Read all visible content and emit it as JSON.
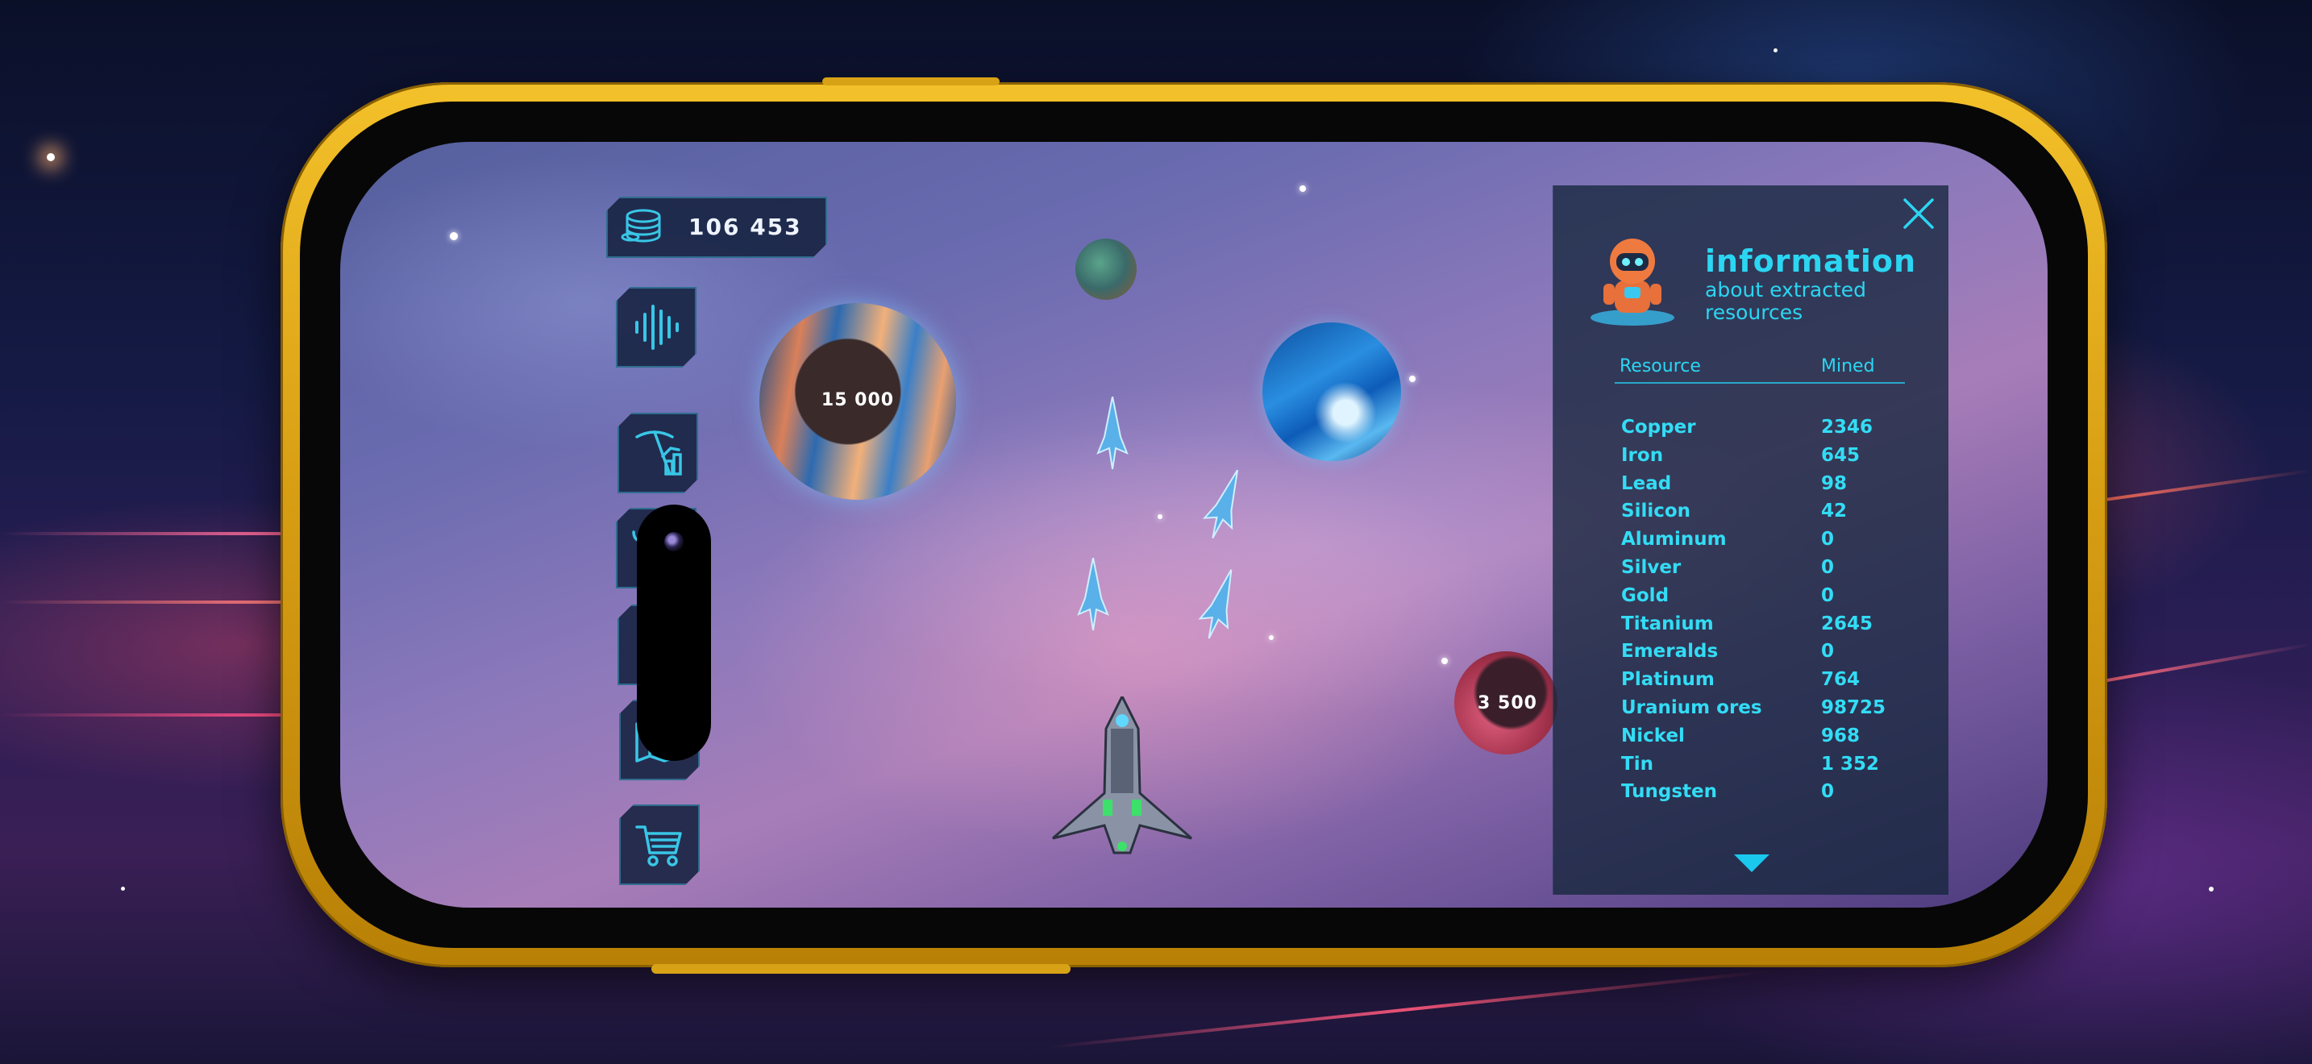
{
  "hud": {
    "coins": "106 453"
  },
  "planets": {
    "large_value": "15 000",
    "small_value": "3 500"
  },
  "info_panel": {
    "title": "information",
    "subtitle": "about extracted resources",
    "col_resource": "Resource",
    "col_mined": "Mined",
    "rows": [
      {
        "name": "Copper",
        "mined": "2346"
      },
      {
        "name": "Iron",
        "mined": "645"
      },
      {
        "name": "Lead",
        "mined": "98"
      },
      {
        "name": "Silicon",
        "mined": "42"
      },
      {
        "name": "Aluminum",
        "mined": "0"
      },
      {
        "name": "Silver",
        "mined": "0"
      },
      {
        "name": "Gold",
        "mined": "0"
      },
      {
        "name": "Titanium",
        "mined": "2645"
      },
      {
        "name": "Emeralds",
        "mined": "0"
      },
      {
        "name": "Platinum",
        "mined": "764"
      },
      {
        "name": "Uranium ores",
        "mined": "98725"
      },
      {
        "name": "Nickel",
        "mined": "968"
      },
      {
        "name": "Tin",
        "mined": "1 352"
      },
      {
        "name": "Tungsten",
        "mined": "0"
      }
    ]
  },
  "sidebar_icons": [
    "sound-wave-icon",
    "mining-pickaxe-icon",
    "cart-exchange-icon",
    "globe-icon",
    "map-icon",
    "shopping-cart-icon"
  ],
  "colors": {
    "accent": "#2bd6f2",
    "phone_frame": "#e2ab18",
    "panel_bg": "#16263c"
  }
}
